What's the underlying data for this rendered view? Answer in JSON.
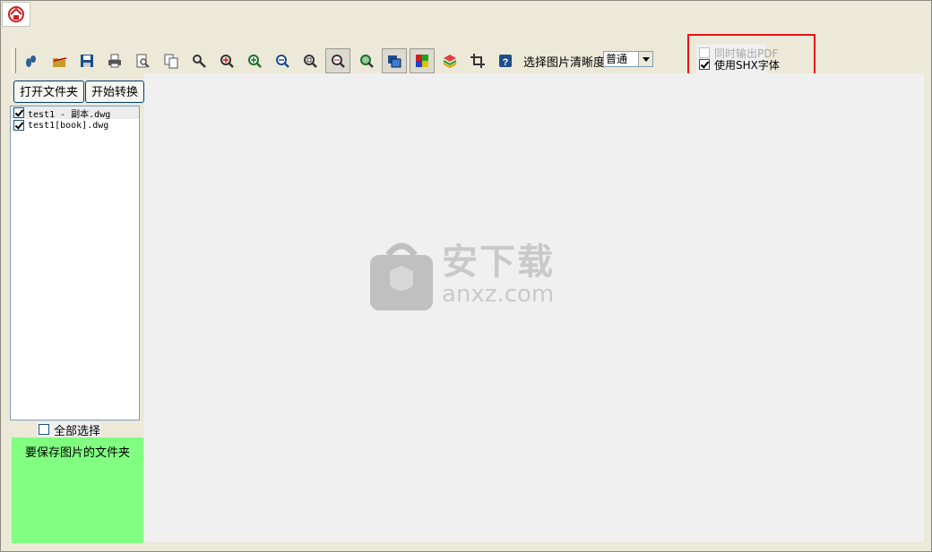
{
  "toolbar": {
    "buttons": [
      {
        "name": "footprint-icon",
        "color": "#2a5f9e"
      },
      {
        "name": "open-folder-icon",
        "color": "#c89a2a"
      },
      {
        "name": "save-icon",
        "color": "#1f4d8a"
      },
      {
        "name": "print-icon",
        "color": "#555555"
      },
      {
        "name": "print-preview-icon",
        "color": "#555555"
      },
      {
        "name": "copy-page-icon",
        "color": "#555555"
      },
      {
        "name": "search-icon",
        "color": "#333333"
      },
      {
        "name": "pan-icon",
        "color": "#333333"
      },
      {
        "name": "zoom-in-icon",
        "color": "#1a6e2a"
      },
      {
        "name": "zoom-out-icon",
        "color": "#1a4e8a"
      },
      {
        "name": "zoom-extents-icon",
        "color": "#333333"
      },
      {
        "name": "zoom-window-icon",
        "color": "#333333"
      },
      {
        "name": "zoom-realtime-icon",
        "color": "#1a6e2a"
      },
      {
        "name": "background-color-icon",
        "color": "#1f4d8a"
      },
      {
        "name": "color-palette-icon",
        "color": "#d02020"
      },
      {
        "name": "layers-icon",
        "color": "#e0a000"
      },
      {
        "name": "crop-icon",
        "color": "#333333"
      },
      {
        "name": "help-icon",
        "color": "#1f4d8a"
      }
    ],
    "quality_label": "选择图片清晰度:",
    "quality_value": "普通"
  },
  "options": {
    "output_pdf_label": "同时输出PDF",
    "output_pdf_checked": false,
    "output_pdf_enabled": false,
    "use_shx_label": "使用SHX字体",
    "use_shx_checked": true
  },
  "buttons": {
    "open_folder": "打开文件夹",
    "start_convert": "开始转换"
  },
  "files": [
    {
      "name": "test1 - 副本.dwg",
      "checked": true
    },
    {
      "name": "test1[book].dwg",
      "checked": true
    }
  ],
  "select_all": {
    "label": "全部选择",
    "checked": false
  },
  "save_panel": {
    "label": "要保存图片的文件夹",
    "color": "#80ff80"
  },
  "watermark": {
    "title": "安下载",
    "sub": "anxz.com"
  },
  "colors": {
    "highlight": "#e8101a",
    "background": "#ece9d8"
  }
}
